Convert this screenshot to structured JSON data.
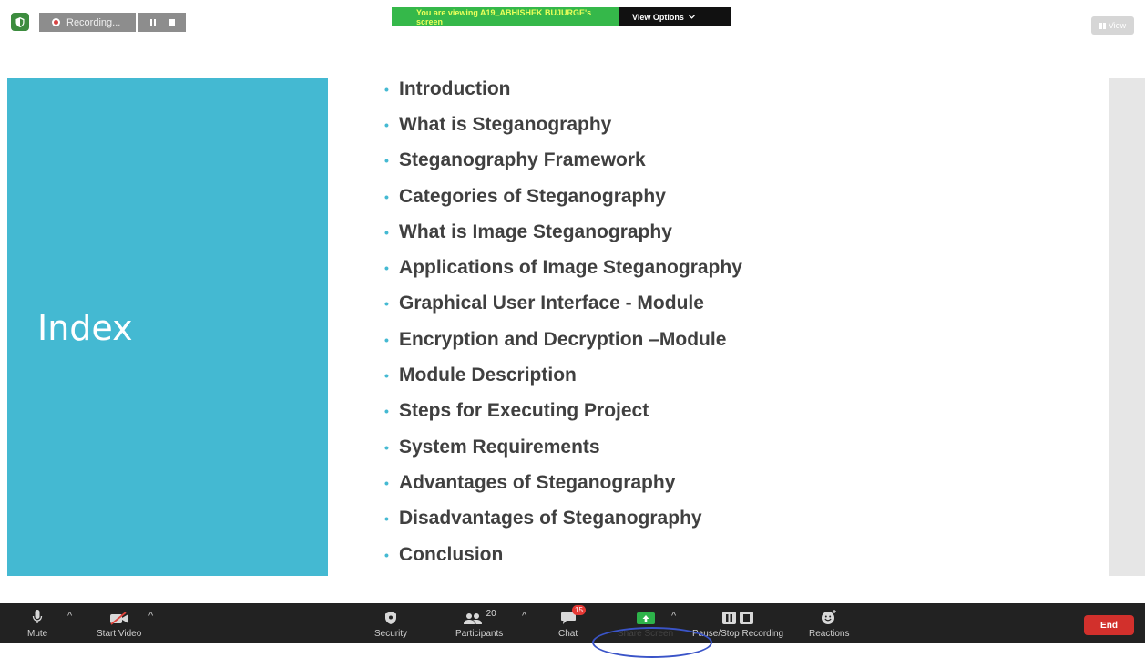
{
  "recording": {
    "label": "Recording..."
  },
  "banner": {
    "viewing_text": "You are viewing A19_ABHISHEK BUJURGE's screen",
    "options_label": "View Options"
  },
  "view_button": {
    "label": "View"
  },
  "slide": {
    "title": "Index",
    "items": [
      "Introduction",
      "What is Steganography",
      "Steganography Framework",
      "Categories of Steganography",
      "What is Image Steganography",
      "Applications of Image Steganography",
      "Graphical User Interface - Module",
      "Encryption and Decryption –Module",
      "Module Description",
      "Steps for Executing Project",
      "System Requirements",
      "Advantages of Steganography",
      "Disadvantages of Steganography",
      "Conclusion"
    ],
    "accent_color": "#44b9d2"
  },
  "toolbar": {
    "mute": "Mute",
    "start_video": "Start Video",
    "security": "Security",
    "participants": "Participants",
    "participants_count": "20",
    "chat": "Chat",
    "chat_badge": "15",
    "share_screen": "Share Screen",
    "recording": "Pause/Stop Recording",
    "reactions": "Reactions",
    "end": "End"
  },
  "icons": [
    "shield-icon",
    "record-dot-icon",
    "pause-icon",
    "stop-icon",
    "chevron-down-icon",
    "grid-icon",
    "microphone-icon",
    "video-off-icon",
    "caret-up-icon",
    "security-shield-icon",
    "participants-icon",
    "chat-icon",
    "share-screen-icon",
    "pause-stop-recording-icon",
    "reactions-icon"
  ]
}
